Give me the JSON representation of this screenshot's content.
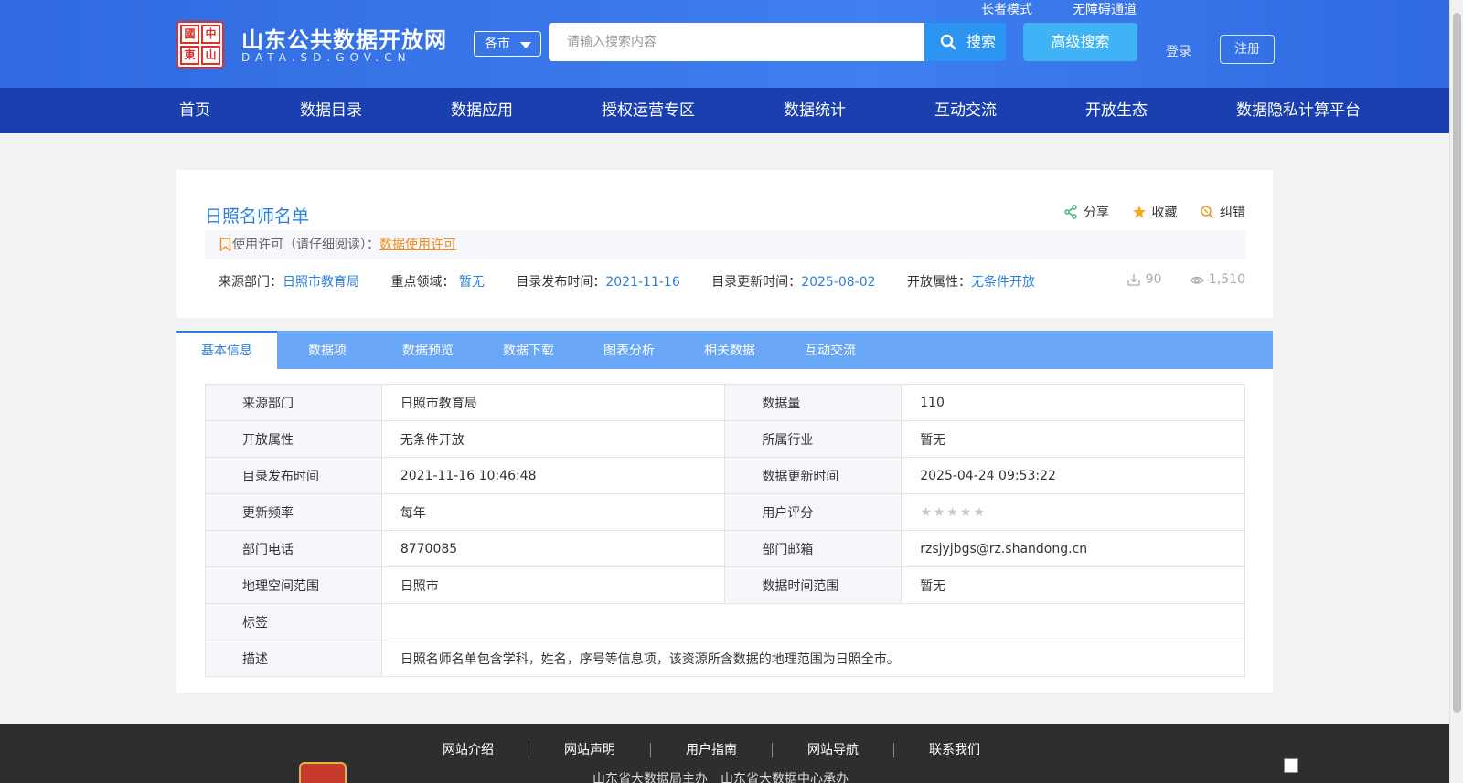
{
  "header": {
    "logo_seal_chars": [
      "中",
      "國",
      "山",
      "東"
    ],
    "site_title": "山东公共数据开放网",
    "site_domain": "DATA.SD.GOV.CN",
    "city_select": "各市",
    "search_placeholder": "请输入搜索内容",
    "search_button": "搜索",
    "advanced_search": "高级搜索",
    "elder_mode": "长者模式",
    "accessibility": "无障碍通道",
    "login": "登录",
    "register": "注册"
  },
  "nav": [
    "首页",
    "数据目录",
    "数据应用",
    "授权运营专区",
    "数据统计",
    "互动交流",
    "开放生态",
    "数据隐私计算平台"
  ],
  "dataset": {
    "title": "日照名师名单",
    "actions": {
      "share": "分享",
      "favorite": "收藏",
      "report": "纠错"
    },
    "license_label": "使用许可（请仔细阅读）：",
    "license_link": "数据使用许可",
    "meta": {
      "source_label": "来源部门：",
      "source": "日照市教育局",
      "domain_label": "重点领域：",
      "domain": "暂无",
      "publish_label": "目录发布时间：",
      "publish": "2021-11-16",
      "update_label": "目录更新时间：",
      "update": "2025-08-02",
      "open_label": "开放属性：",
      "open": "无条件开放"
    },
    "downloads": "90",
    "views": "1,510"
  },
  "tabs": [
    "基本信息",
    "数据项",
    "数据预览",
    "数据下载",
    "图表分析",
    "相关数据",
    "互动交流"
  ],
  "info_rows": [
    {
      "k1": "来源部门",
      "v1": "日照市教育局",
      "k2": "数据量",
      "v2": "110"
    },
    {
      "k1": "开放属性",
      "v1": "无条件开放",
      "k2": "所属行业",
      "v2": "暂无"
    },
    {
      "k1": "目录发布时间",
      "v1": "2021-11-16 10:46:48",
      "k2": "数据更新时间",
      "v2": "2025-04-24 09:53:22"
    },
    {
      "k1": "更新频率",
      "v1": "每年",
      "k2": "用户评分",
      "rating": 0
    },
    {
      "k1": "部门电话",
      "v1": "8770085",
      "k2": "部门邮箱",
      "v2": "rzsjyjbgs@rz.shandong.cn"
    },
    {
      "k1": "地理空间范围",
      "v1": "日照市",
      "k2": "数据时间范围",
      "v2": "暂无"
    }
  ],
  "tags_label": "标签",
  "tags_value": "",
  "desc_label": "描述",
  "desc_value": "日照名师名单包含学科，姓名，序号等信息项，该资源所含数据的地理范围为日照全市。",
  "footer": {
    "links": [
      "网站介绍",
      "网站声明",
      "用户指南",
      "网站导航",
      "联系我们"
    ],
    "line": "山东省大数据局主办　山东省大数据中心承办"
  },
  "colors": {
    "nav_bg": "#1a3fae",
    "header_bg": "#3a78ea",
    "link_blue": "#2b7fd8",
    "license_orange": "#f08d20",
    "tab_bg": "#6aa8f7"
  }
}
